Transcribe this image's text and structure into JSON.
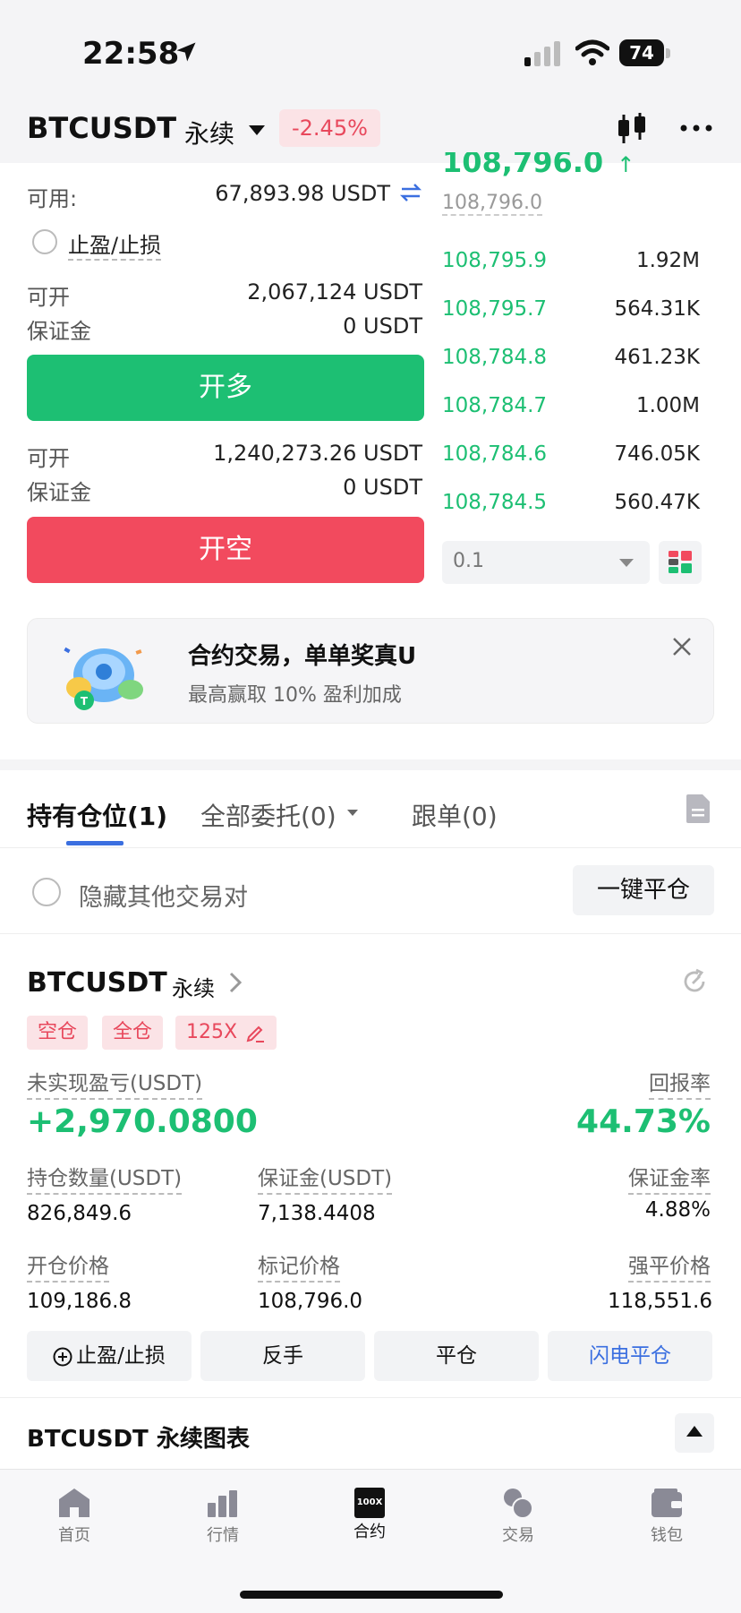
{
  "status_bar": {
    "time": "22:58",
    "battery": "74"
  },
  "header": {
    "symbol": "BTCUSDT",
    "contract_type": "永续",
    "change": "-2.45%"
  },
  "trade_panel": {
    "available_label": "可用:",
    "available_value": "67,893.98 USDT",
    "tpsl_label": "止盈/止损",
    "long": {
      "openable_label": "可开",
      "openable_value": "2,067,124 USDT",
      "margin_label": "保证金",
      "margin_value": "0 USDT",
      "button_label": "开多"
    },
    "short": {
      "openable_label": "可开",
      "openable_value": "1,240,273.26 USDT",
      "margin_label": "保证金",
      "margin_value": "0 USDT",
      "button_label": "开空"
    }
  },
  "order_book": {
    "last_price": "108,796.0",
    "last_arrow": "↑",
    "mark_price": "108,796.0",
    "bids": [
      {
        "price": "108,795.9",
        "qty": "1.92M"
      },
      {
        "price": "108,795.7",
        "qty": "564.31K"
      },
      {
        "price": "108,784.8",
        "qty": "461.23K"
      },
      {
        "price": "108,784.7",
        "qty": "1.00M"
      },
      {
        "price": "108,784.6",
        "qty": "746.05K"
      },
      {
        "price": "108,784.5",
        "qty": "560.47K"
      }
    ],
    "precision": "0.1"
  },
  "banner": {
    "title": "合约交易，单单奖真U",
    "subtitle": "最高赢取 10% 盈利加成"
  },
  "tabs": [
    {
      "label": "持有仓位(1)"
    },
    {
      "label": "全部委托(0)"
    },
    {
      "label": "跟单(0)"
    }
  ],
  "filter": {
    "hide_label": "隐藏其他交易对",
    "close_all_label": "一键平仓"
  },
  "position": {
    "symbol": "BTCUSDT",
    "contract_type": "永续",
    "tags": [
      "空仓",
      "全仓",
      "125X"
    ],
    "pnl_label": "未实现盈亏(USDT)",
    "pnl_value": "+2,970.0800",
    "roe_label": "回报率",
    "roe_value": "44.73%",
    "size_label": "持仓数量(USDT)",
    "size_value": "826,849.6",
    "margin_label": "保证金(USDT)",
    "margin_value": "7,138.4408",
    "margin_rate_label": "保证金率",
    "margin_rate_value": "4.88%",
    "entry_label": "开仓价格",
    "entry_value": "109,186.8",
    "mark_label": "标记价格",
    "mark_value": "108,796.0",
    "liq_label": "强平价格",
    "liq_value": "118,551.6",
    "actions": {
      "tpsl": "止盈/止损",
      "reverse": "反手",
      "close": "平仓",
      "flash_close": "闪电平仓"
    }
  },
  "chart_section": {
    "title": "BTCUSDT 永续图表"
  },
  "nav": [
    {
      "label": "首页",
      "icon": "home-icon"
    },
    {
      "label": "行情",
      "icon": "market-icon"
    },
    {
      "label": "合约",
      "icon": "futures-icon",
      "badge": "100X"
    },
    {
      "label": "交易",
      "icon": "trade-icon"
    },
    {
      "label": "钱包",
      "icon": "wallet-icon"
    }
  ],
  "colors": {
    "green": "#1dbf73",
    "red": "#f24a5e",
    "blue": "#3b6fe0"
  }
}
